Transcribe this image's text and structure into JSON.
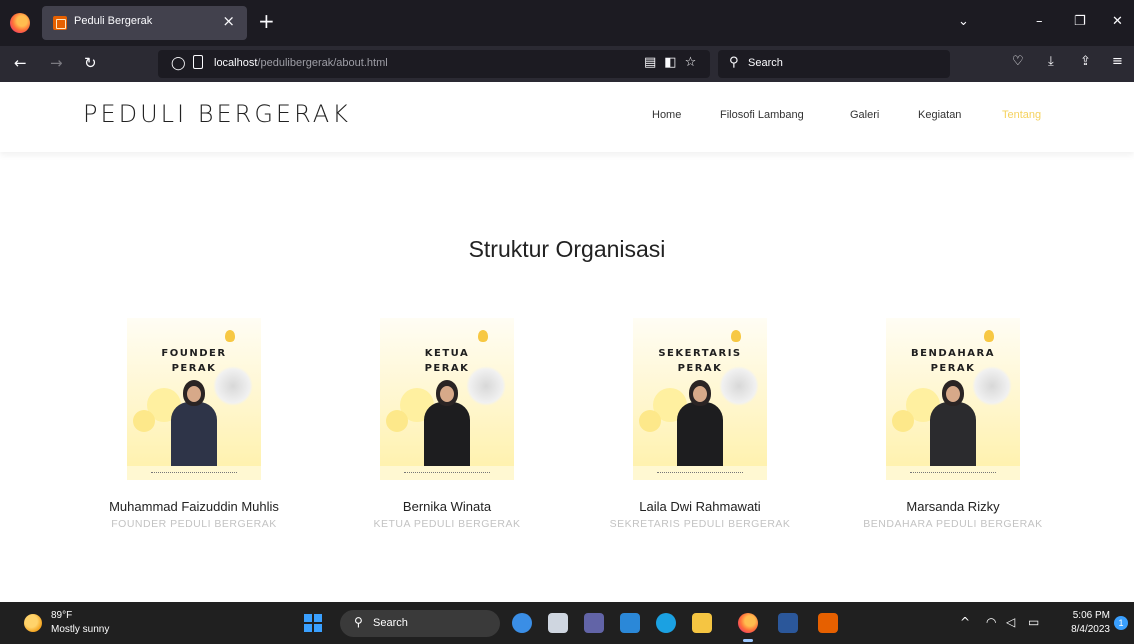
{
  "browser": {
    "tab_title": "Peduli Bergerak",
    "url_host": "localhost",
    "url_path": "/pedulibergerak/about.html",
    "search_placeholder": "Search"
  },
  "site": {
    "logo": "PEDULI BERGERAK",
    "nav": [
      {
        "label": "Home",
        "active": false
      },
      {
        "label": "Filosofi Lambang",
        "active": false
      },
      {
        "label": "Galeri",
        "active": false
      },
      {
        "label": "Kegiatan",
        "active": false
      },
      {
        "label": "Tentang",
        "active": true
      }
    ],
    "accent_color": "#f5d25e"
  },
  "section": {
    "title": "Struktur Organisasi"
  },
  "members": [
    {
      "photo_title_1": "FOUNDER",
      "photo_title_2": "PERAK",
      "name": "Muhammad Faizuddin Muhlis",
      "role": "FOUNDER PEDULI BERGERAK"
    },
    {
      "photo_title_1": "KETUA",
      "photo_title_2": "PERAK",
      "name": "Bernika Winata",
      "role": "KETUA PEDULI BERGERAK"
    },
    {
      "photo_title_1": "SEKERTARIS",
      "photo_title_2": "PERAK",
      "name": "Laila Dwi Rahmawati",
      "role": "SEKRETARIS PEDULI BERGERAK"
    },
    {
      "photo_title_1": "BENDAHARA",
      "photo_title_2": "PERAK",
      "name": "Marsanda Rizky",
      "role": "BENDAHARA PEDULI BERGERAK"
    }
  ],
  "taskbar": {
    "temperature": "89°F",
    "weather": "Mostly sunny",
    "search_placeholder": "Search",
    "time": "5:06 PM",
    "date": "8/4/2023",
    "notification_count": "1"
  }
}
